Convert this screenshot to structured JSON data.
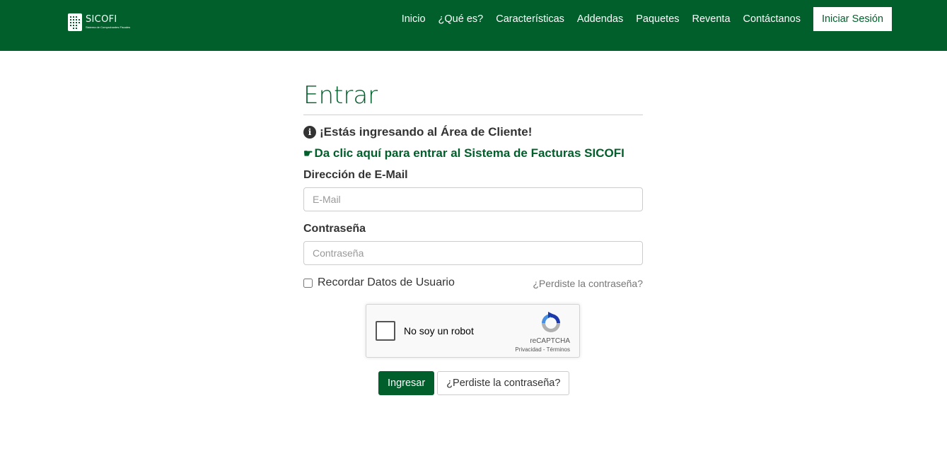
{
  "brand": {
    "name": "SICOFI",
    "tagline": "Sistema de Comprobantes Fiscales",
    "logo_icon": "sicofi-logo-icon"
  },
  "nav": {
    "links": [
      "Inicio",
      "¿Qué es?",
      "Características",
      "Addendas",
      "Paquetes",
      "Reventa",
      "Contáctanos"
    ],
    "login_label": "Iniciar Sesión"
  },
  "main": {
    "title": "Entrar",
    "notice": "¡Estás ingresando al Área de Cliente!",
    "notice_icon": "info-circle-icon",
    "cta": "Da clic aquí para entrar al Sistema de Facturas SICOFI",
    "cta_icon": "hand-pointing-right-icon",
    "email_label": "Dirección de E-Mail",
    "email_placeholder": "E-Mail",
    "email_value": "",
    "password_label": "Contraseña",
    "password_placeholder": "Contraseña",
    "password_value": "",
    "remember_label": "Recordar Datos de Usuario",
    "remember_checked": false,
    "forgot_link": "¿Perdiste la contraseña?"
  },
  "captcha": {
    "label": "No soy un robot",
    "brand": "reCAPTCHA",
    "privacy": "Privacidad",
    "separator": " - ",
    "terms": "Términos",
    "checked": false
  },
  "buttons": {
    "submit": "Ingresar",
    "forgot": "¿Perdiste la contraseña?"
  },
  "colors": {
    "primary": "#005f2a",
    "text": "#333333",
    "border": "#cccccc",
    "muted": "#777777"
  }
}
